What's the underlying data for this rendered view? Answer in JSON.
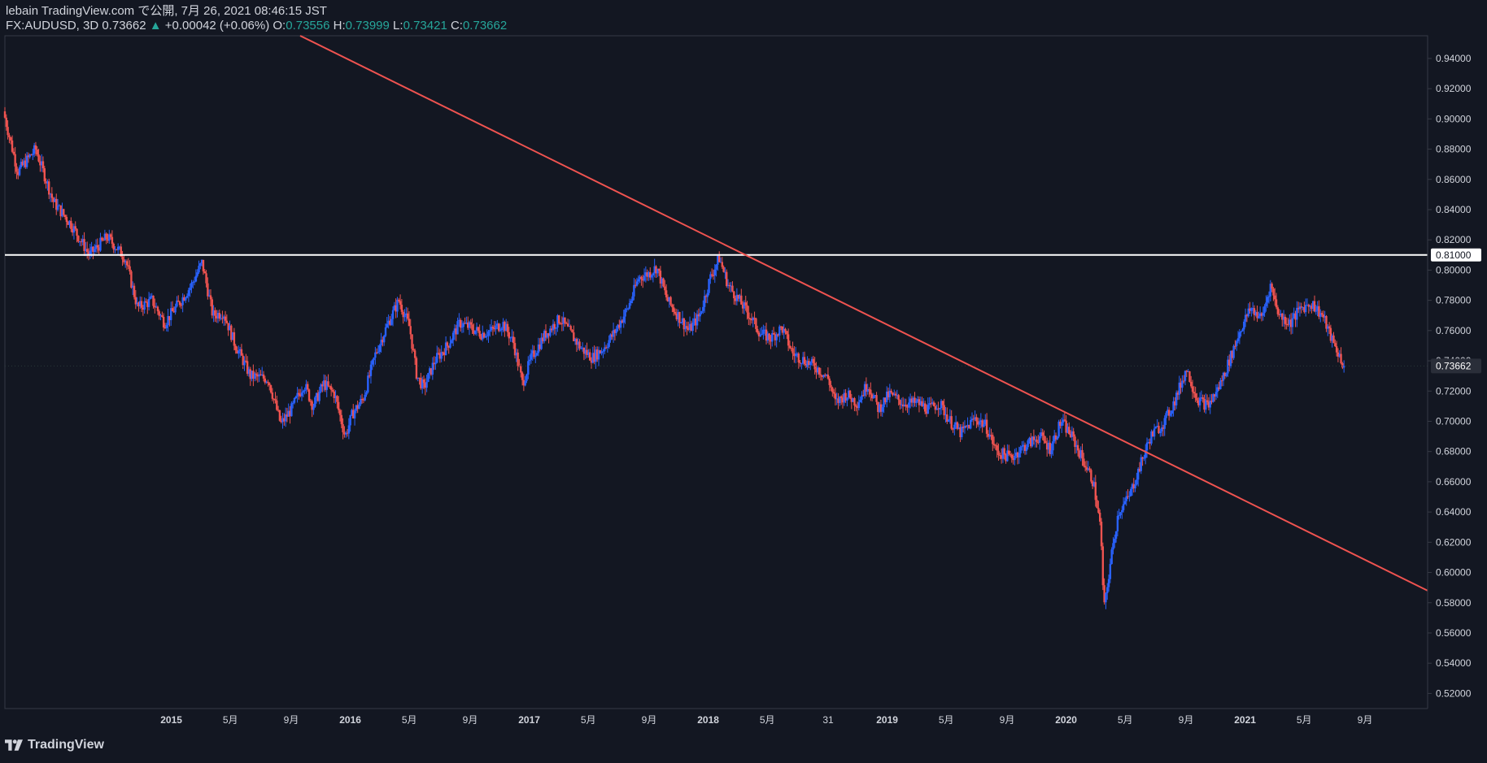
{
  "header": {
    "title": "lebain TradingView.com で公開, 7月 26, 2021 08:46:15 JST",
    "symbol": "FX:AUDUSD, 3D 0.73662",
    "change_arrow": "▲",
    "change": "+0.00042 (+0.06%)",
    "o_label": "O:",
    "o_value": "0.73556",
    "h_label": "H:",
    "h_value": "0.73999",
    "l_label": "L:",
    "l_value": "0.73421",
    "c_label": "C:",
    "c_value": "0.73662"
  },
  "footer": {
    "brand": "TradingView",
    "logo_icon": "tradingview-logo-icon"
  },
  "colors": {
    "background": "#131722",
    "up": "#2962ff",
    "down": "#ef5350",
    "trendline": "#ef5350",
    "level": "#ffffff",
    "axis_text": "#d1d4dc",
    "axis_line": "#363a45"
  },
  "chart_data": {
    "type": "candlestick",
    "symbol": "FX:AUDUSD",
    "timeframe": "3D",
    "ylim": [
      0.51,
      0.955
    ],
    "y_ticks": [
      "0.94000",
      "0.92000",
      "0.90000",
      "0.88000",
      "0.86000",
      "0.84000",
      "0.82000",
      "0.80000",
      "0.78000",
      "0.76000",
      "0.74000",
      "0.72000",
      "0.70000",
      "0.68000",
      "0.66000",
      "0.64000",
      "0.62000",
      "0.60000",
      "0.58000",
      "0.56000",
      "0.54000",
      "0.52000"
    ],
    "x_ticks": [
      {
        "label": "2015",
        "bold": true,
        "t": 2015.0
      },
      {
        "label": "5月",
        "bold": false,
        "t": 2015.33
      },
      {
        "label": "9月",
        "bold": false,
        "t": 2015.67
      },
      {
        "label": "2016",
        "bold": true,
        "t": 2016.0
      },
      {
        "label": "5月",
        "bold": false,
        "t": 2016.33
      },
      {
        "label": "9月",
        "bold": false,
        "t": 2016.67
      },
      {
        "label": "2017",
        "bold": true,
        "t": 2017.0
      },
      {
        "label": "5月",
        "bold": false,
        "t": 2017.33
      },
      {
        "label": "9月",
        "bold": false,
        "t": 2017.67
      },
      {
        "label": "2018",
        "bold": true,
        "t": 2018.0
      },
      {
        "label": "5月",
        "bold": false,
        "t": 2018.33
      },
      {
        "label": "31",
        "bold": false,
        "t": 2018.67
      },
      {
        "label": "2019",
        "bold": true,
        "t": 2019.0
      },
      {
        "label": "5月",
        "bold": false,
        "t": 2019.33
      },
      {
        "label": "9月",
        "bold": false,
        "t": 2019.67
      },
      {
        "label": "2020",
        "bold": true,
        "t": 2020.0
      },
      {
        "label": "5月",
        "bold": false,
        "t": 2020.33
      },
      {
        "label": "9月",
        "bold": false,
        "t": 2020.67
      },
      {
        "label": "2021",
        "bold": true,
        "t": 2021.0
      },
      {
        "label": "5月",
        "bold": false,
        "t": 2021.33
      },
      {
        "label": "9月",
        "bold": false,
        "t": 2021.67
      }
    ],
    "price_path": [
      [
        2014.07,
        0.905
      ],
      [
        2014.15,
        0.865
      ],
      [
        2014.25,
        0.88
      ],
      [
        2014.35,
        0.845
      ],
      [
        2014.45,
        0.83
      ],
      [
        2014.55,
        0.81
      ],
      [
        2014.65,
        0.822
      ],
      [
        2014.75,
        0.808
      ],
      [
        2014.82,
        0.775
      ],
      [
        2014.9,
        0.78
      ],
      [
        2014.97,
        0.765
      ],
      [
        2015.05,
        0.778
      ],
      [
        2015.12,
        0.79
      ],
      [
        2015.18,
        0.805
      ],
      [
        2015.24,
        0.77
      ],
      [
        2015.3,
        0.772
      ],
      [
        2015.36,
        0.752
      ],
      [
        2015.45,
        0.73
      ],
      [
        2015.55,
        0.728
      ],
      [
        2015.62,
        0.698
      ],
      [
        2015.68,
        0.708
      ],
      [
        2015.75,
        0.725
      ],
      [
        2015.8,
        0.71
      ],
      [
        2015.86,
        0.725
      ],
      [
        2015.92,
        0.718
      ],
      [
        2015.98,
        0.69
      ],
      [
        2016.02,
        0.705
      ],
      [
        2016.08,
        0.715
      ],
      [
        2016.15,
        0.745
      ],
      [
        2016.22,
        0.765
      ],
      [
        2016.28,
        0.78
      ],
      [
        2016.34,
        0.762
      ],
      [
        2016.38,
        0.73
      ],
      [
        2016.42,
        0.722
      ],
      [
        2016.48,
        0.74
      ],
      [
        2016.55,
        0.75
      ],
      [
        2016.62,
        0.765
      ],
      [
        2016.68,
        0.762
      ],
      [
        2016.74,
        0.758
      ],
      [
        2016.8,
        0.76
      ],
      [
        2016.86,
        0.765
      ],
      [
        2016.92,
        0.752
      ],
      [
        2016.97,
        0.725
      ],
      [
        2017.02,
        0.742
      ],
      [
        2017.1,
        0.758
      ],
      [
        2017.18,
        0.768
      ],
      [
        2017.24,
        0.758
      ],
      [
        2017.3,
        0.748
      ],
      [
        2017.36,
        0.742
      ],
      [
        2017.42,
        0.748
      ],
      [
        2017.48,
        0.758
      ],
      [
        2017.56,
        0.775
      ],
      [
        2017.62,
        0.795
      ],
      [
        2017.68,
        0.798
      ],
      [
        2017.72,
        0.802
      ],
      [
        2017.78,
        0.78
      ],
      [
        2017.84,
        0.77
      ],
      [
        2017.9,
        0.76
      ],
      [
        2017.96,
        0.77
      ],
      [
        2018.02,
        0.795
      ],
      [
        2018.07,
        0.808
      ],
      [
        2018.12,
        0.79
      ],
      [
        2018.18,
        0.78
      ],
      [
        2018.24,
        0.77
      ],
      [
        2018.3,
        0.758
      ],
      [
        2018.36,
        0.755
      ],
      [
        2018.42,
        0.762
      ],
      [
        2018.48,
        0.745
      ],
      [
        2018.55,
        0.74
      ],
      [
        2018.62,
        0.735
      ],
      [
        2018.68,
        0.728
      ],
      [
        2018.72,
        0.712
      ],
      [
        2018.78,
        0.718
      ],
      [
        2018.84,
        0.712
      ],
      [
        2018.9,
        0.725
      ],
      [
        2018.96,
        0.708
      ],
      [
        2019.02,
        0.718
      ],
      [
        2019.1,
        0.712
      ],
      [
        2019.18,
        0.712
      ],
      [
        2019.24,
        0.708
      ],
      [
        2019.3,
        0.712
      ],
      [
        2019.36,
        0.7
      ],
      [
        2019.42,
        0.692
      ],
      [
        2019.5,
        0.702
      ],
      [
        2019.56,
        0.697
      ],
      [
        2019.62,
        0.68
      ],
      [
        2019.7,
        0.676
      ],
      [
        2019.78,
        0.684
      ],
      [
        2019.86,
        0.69
      ],
      [
        2019.92,
        0.682
      ],
      [
        2019.98,
        0.7
      ],
      [
        2020.04,
        0.69
      ],
      [
        2020.1,
        0.675
      ],
      [
        2020.16,
        0.66
      ],
      [
        2020.2,
        0.63
      ],
      [
        2020.22,
        0.575
      ],
      [
        2020.26,
        0.61
      ],
      [
        2020.3,
        0.64
      ],
      [
        2020.36,
        0.65
      ],
      [
        2020.42,
        0.67
      ],
      [
        2020.48,
        0.69
      ],
      [
        2020.56,
        0.7
      ],
      [
        2020.62,
        0.715
      ],
      [
        2020.68,
        0.735
      ],
      [
        2020.74,
        0.715
      ],
      [
        2020.8,
        0.71
      ],
      [
        2020.86,
        0.722
      ],
      [
        2020.92,
        0.74
      ],
      [
        2020.98,
        0.76
      ],
      [
        2021.04,
        0.775
      ],
      [
        2021.1,
        0.768
      ],
      [
        2021.15,
        0.79
      ],
      [
        2021.2,
        0.77
      ],
      [
        2021.26,
        0.765
      ],
      [
        2021.32,
        0.775
      ],
      [
        2021.38,
        0.778
      ],
      [
        2021.44,
        0.77
      ],
      [
        2021.5,
        0.752
      ],
      [
        2021.56,
        0.737
      ]
    ],
    "annotations": {
      "trendline": {
        "from": [
          2015.72,
          0.955
        ],
        "to": [
          2022.02,
          0.588
        ],
        "color": "#ef5350"
      },
      "horizontal_level": {
        "value": 0.81,
        "label": "0.81000",
        "color": "#ffffff"
      },
      "last_price": {
        "value": 0.73662,
        "label": "0.73662"
      }
    },
    "x_range": [
      2014.07,
      2022.02
    ],
    "grid": false
  }
}
